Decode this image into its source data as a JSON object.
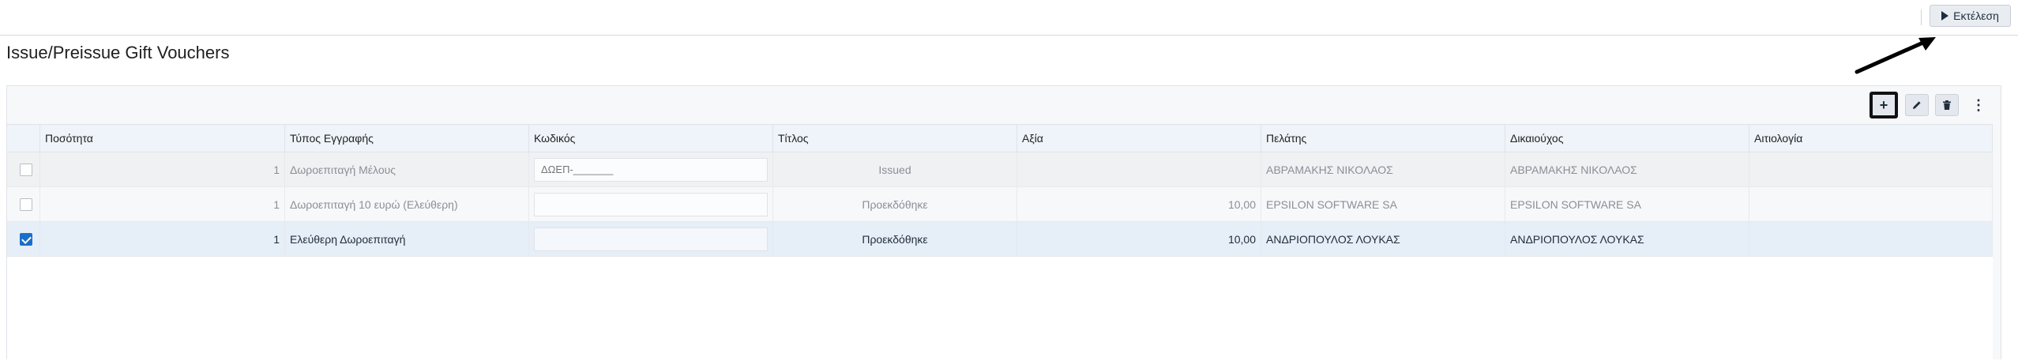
{
  "header": {
    "run_label": "Εκτέλεση"
  },
  "page": {
    "title": "Issue/Preissue Gift Vouchers"
  },
  "toolbar": {
    "add_label": "+",
    "more_label": "⋮"
  },
  "grid": {
    "columns": [
      "Ποσότητα",
      "Τύπος Εγγραφής",
      "Κωδικός",
      "Τίτλος",
      "Αξία",
      "Πελάτης",
      "Δικαιούχος",
      "Αιτιολογία"
    ],
    "rows": [
      {
        "checked": false,
        "quantity": "1",
        "type": "Δωροεπιταγή Μέλους",
        "code": "",
        "code_placeholder": "ΔΩΕΠ-_______",
        "status": "Issued",
        "value": "",
        "customer": "ΑΒΡΑΜΑΚΗΣ ΝΙΚΟΛΑΟΣ",
        "beneficiary": "ΑΒΡΑΜΑΚΗΣ ΝΙΚΟΛΑΟΣ",
        "reason": ""
      },
      {
        "checked": false,
        "quantity": "1",
        "type": "Δωροεπιταγή 10 ευρώ (Ελεύθερη)",
        "code": "",
        "code_placeholder": "",
        "status": "Προεκδόθηκε",
        "value": "10,00",
        "customer": "EPSILON SOFTWARE SA",
        "beneficiary": "EPSILON SOFTWARE SA",
        "reason": ""
      },
      {
        "checked": true,
        "quantity": "1",
        "type": "Ελεύθερη Δωροεπιταγή",
        "code": "",
        "code_placeholder": "",
        "status": "Προεκδόθηκε",
        "value": "10,00",
        "customer": "ΑΝΔΡΙΟΠΟΥΛΟΣ ΛΟΥΚΑΣ",
        "beneficiary": "ΑΝΔΡΙΟΠΟΥΛΟΣ ΛΟΥΚΑΣ",
        "reason": ""
      }
    ]
  },
  "icons": {
    "run": "play-icon",
    "add": "plus-icon",
    "edit": "pencil-icon",
    "delete": "trash-icon",
    "more": "kebab-menu-icon",
    "annotation": "arrow-annotation-icon"
  },
  "colors": {
    "accent": "#1a6fc9",
    "header_bg": "#eef4f9",
    "selected_row": "#e6eef8"
  }
}
